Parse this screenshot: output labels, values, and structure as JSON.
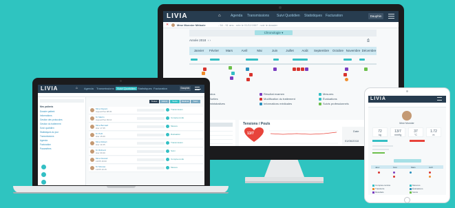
{
  "brand": {
    "name": "LIVIA",
    "accent": "#33bfc4",
    "nav_bg": "#273c4f",
    "background": "#2fc4c0"
  },
  "monitor": {
    "nav_items": [
      "Agenda",
      "Transmissions",
      "Suivi Quotidien",
      "Statistiques",
      "Facturation"
    ],
    "user_button": "Dauphin",
    "patient_line": "Mme Monnier Mélanie",
    "patient_detail": "- 54 - 51 ans - née le 01/11/1967 - voir le dossier",
    "chronology_button": "Chronologie",
    "year_label": "Année 2018",
    "months": [
      "Janvier",
      "Février",
      "Mars",
      "Avril",
      "Mai",
      "Juin",
      "Juillet",
      "Août",
      "Septembre",
      "Octobre",
      "Novembre",
      "Décembre"
    ],
    "legend": [
      {
        "label": "Comptes-rendus",
        "color": "#33bfc4"
      },
      {
        "label": "Transferts / Sorties",
        "color": "#f08c2b"
      },
      {
        "label": "Données administratives",
        "color": "#9aa7b1"
      },
      {
        "label": "Résultat examen",
        "color": "#7a3cc0"
      },
      {
        "label": "Modification du traitement",
        "color": "#d8332d"
      },
      {
        "label": "Informations médicales",
        "color": "#2a8fbd"
      },
      {
        "label": "Mesures",
        "color": "#33bfc4"
      },
      {
        "label": "Évaluations",
        "color": "#33bfc4"
      },
      {
        "label": "Suivis professionnels",
        "color": "#6bbf4a"
      }
    ],
    "tension_title": "Tensions / Pouls",
    "tension_value": "13/7",
    "table_date_header": "Date",
    "table_tension_header": "Tension",
    "table_row_date": "01/06/2018",
    "table_row_value": "13/7"
  },
  "laptop": {
    "nav_items": [
      "Agenda",
      "Transmissions",
      "Suivi Quotidien",
      "Statistiques",
      "Facturation"
    ],
    "user_button": "Dauphin",
    "tabs": [
      "Toutes",
      "Admin",
      "Soins",
      "Médical",
      "Suivi"
    ],
    "sidebar_items": [
      "Mes patients",
      "Dossier patient",
      "Informations",
      "Gestion des protocoles",
      "Gestion du traitement",
      "Suivi quotidien",
      "Statistiques du jour",
      "Transmissions",
      "Agenda",
      "Facturation",
      "Paramètres"
    ],
    "rows": [
      {
        "name": "Mme Dupont",
        "time": "Aujourd'hui 08:30",
        "status": "Transmission"
      },
      {
        "name": "M. Martin",
        "time": "Aujourd'hui 09:10",
        "status": "Compte-rendu"
      },
      {
        "name": "Mme Bernard",
        "time": "Hier 17:45",
        "status": "Mesure"
      },
      {
        "name": "M. Petit",
        "time": "Hier 15:20",
        "status": "Évaluation"
      },
      {
        "name": "Mme Robert",
        "time": "Hier 11:05",
        "status": "Transmission"
      },
      {
        "name": "M. Richard",
        "time": "Hier 09:40",
        "status": "Suivi"
      },
      {
        "name": "Mme Durand",
        "time": "12/05 16:00",
        "status": "Compte-rendu"
      },
      {
        "name": "M. Moreau",
        "time": "12/05 10:15",
        "status": "Mesure"
      }
    ]
  },
  "tablet": {
    "patient_name": "Mme Monnier",
    "stats": [
      {
        "value": "72",
        "label": "kg"
      },
      {
        "value": "13/7",
        "label": "mmHg"
      },
      {
        "value": "37",
        "label": "°C"
      },
      {
        "value": "1.72",
        "label": "m"
      }
    ],
    "months": [
      "Janv",
      "Févr",
      "Mars",
      "Avril"
    ],
    "legend": [
      "Comptes-rendus",
      "Transferts",
      "Résultats",
      "Mesures",
      "Évaluations",
      "Suivis"
    ]
  }
}
